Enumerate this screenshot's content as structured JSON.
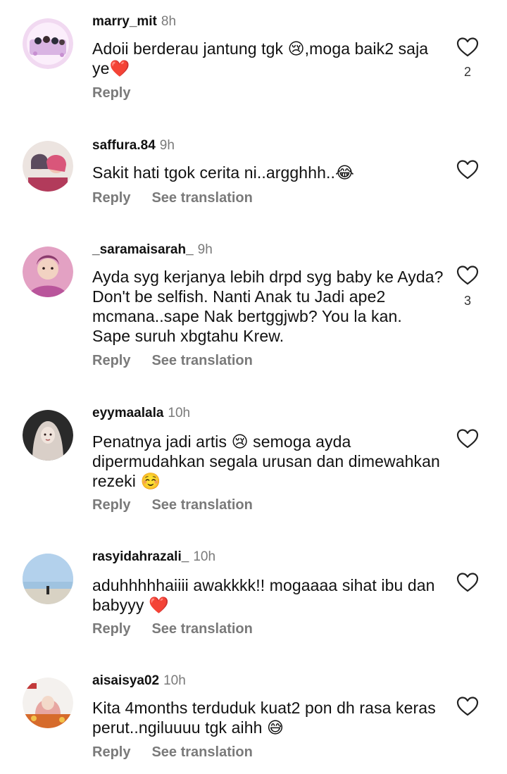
{
  "comments": [
    {
      "username": "marry_mit",
      "time": "8h",
      "text": "Adoii berderau jantung tgk 😢,moga baik2 saja ye❤️",
      "reply": "Reply",
      "see_translation": "",
      "likes": "2",
      "avatar_colors": [
        "#f3dff2",
        "#c78fd1",
        "#2c2c3a"
      ]
    },
    {
      "username": "saffura.84",
      "time": "9h",
      "text": "Sakit hati tgok cerita ni..argghhh..😂",
      "reply": "Reply",
      "see_translation": "See translation",
      "likes": "",
      "avatar_colors": [
        "#e9e0dc",
        "#d9567a",
        "#5b4b5e"
      ]
    },
    {
      "username": "_saramaisarah_",
      "time": "9h",
      "text": "Ayda syg kerjanya lebih drpd syg baby ke Ayda? Don't be selfish. Nanti Anak tu Jadi ape2 mcmana..sape Nak bertggjwb? You la kan. Sape suruh xbgtahu Krew.",
      "reply": "Reply",
      "see_translation": "See translation",
      "likes": "3",
      "avatar_colors": [
        "#e6a7c6",
        "#b9559b",
        "#f2d2c2"
      ]
    },
    {
      "username": "eyymaalala",
      "time": "10h",
      "text": "Penatnya jadi artis 😢 semoga ayda dipermudahkan segala urusan dan dimewahkan rezeki ☺️",
      "reply": "Reply",
      "see_translation": "See translation",
      "likes": "",
      "avatar_colors": [
        "#2a2a2a",
        "#d9cfc8",
        "#f0e4dc"
      ]
    },
    {
      "username": "rasyidahrazali_",
      "time": "10h",
      "text": "aduhhhhhaiiii awakkkk!! mogaaaa sihat ibu dan babyyy ❤️",
      "reply": "Reply",
      "see_translation": "See translation",
      "likes": "",
      "avatar_colors": [
        "#bcd6ee",
        "#8fb7d9",
        "#d8d2c4"
      ]
    },
    {
      "username": "aisaisya02",
      "time": "10h",
      "text": "Kita 4months terduduk kuat2 pon dh rasa keras perut..ngiluuuu tgk aihh 😅",
      "reply": "Reply",
      "see_translation": "See translation",
      "likes": "",
      "avatar_colors": [
        "#f4f1ee",
        "#e7a6a1",
        "#d66b2c"
      ]
    }
  ]
}
